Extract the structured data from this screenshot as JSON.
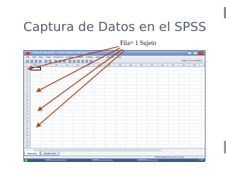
{
  "slide": {
    "title": "Captura de Datos en el SPSS",
    "annotation": "Fila= 1 Sujeto",
    "arrow_color": "#b5441c"
  },
  "spss": {
    "window_title": "Untitled1 [DataSet0] - PASW Statistics Data Editor",
    "menu": [
      "File",
      "Edit",
      "View",
      "Data",
      "Transform",
      "Analyze",
      "Graphs",
      "Utilities",
      "Add-ons",
      "Window",
      "Help"
    ],
    "visible_label": "Visible: 0 of 0 Variables",
    "column_header": "var",
    "row_numbers": [
      "1",
      "2",
      "3",
      "4",
      "5",
      "6",
      "7",
      "8",
      "9",
      "10",
      "11",
      "12",
      "13",
      "14",
      "15",
      "16",
      "17",
      "18",
      "19",
      "20",
      "21",
      "22",
      "23"
    ],
    "tabs": [
      "Data View",
      "Variable View"
    ],
    "status_text": "PASW Statistics Processor is ready",
    "taskbar_items": [
      "SPSS",
      "Untitled1",
      "Presentación"
    ],
    "clock": "10:25"
  },
  "colors": {
    "title": "#555c6b",
    "window_titlebar": "#5f86c4",
    "accent_deco": "#8a8a8a"
  }
}
